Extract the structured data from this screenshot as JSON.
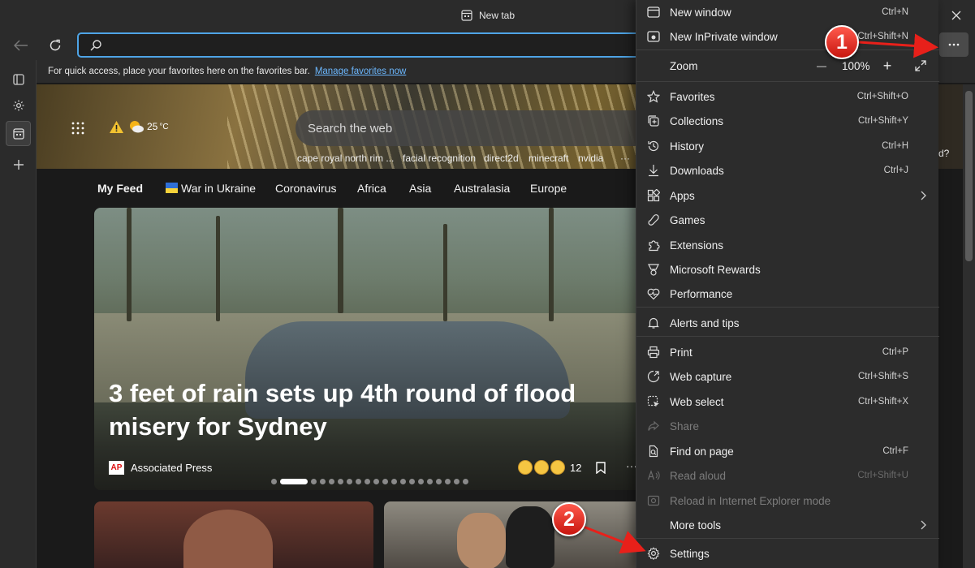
{
  "window": {
    "tab_title": "New tab"
  },
  "toolbar": {
    "address_value": ""
  },
  "favorites_bar": {
    "message": "For quick access, place your favorites here on the favorites bar.",
    "link": "Manage favorites now"
  },
  "hero": {
    "weather_temp": "25",
    "weather_unit": "°C",
    "search_placeholder": "Search the web",
    "trending": [
      "cape royal north rim ...",
      "facial recognition",
      "direct2d",
      "minecraft",
      "nvidia"
    ],
    "more": "···",
    "right_snippet": "d?"
  },
  "feed_tabs": [
    "My Feed",
    "War in Ukraine",
    "Coronavirus",
    "Africa",
    "Asia",
    "Australasia",
    "Europe"
  ],
  "top_story": {
    "headline": "3 feet of rain sets up 4th round of flood misery for Sydney",
    "source": "Associated Press",
    "source_logo": "AP",
    "reaction_count": "12",
    "more": "···",
    "carousel_count": 20,
    "carousel_active": 1
  },
  "menu": {
    "items": [
      {
        "label": "New window",
        "shortcut": "Ctrl+N",
        "icon": "window-icon"
      },
      {
        "label": "New InPrivate window",
        "shortcut": "Ctrl+Shift+N",
        "icon": "inprivate-icon"
      },
      {
        "label": "Favorites",
        "shortcut": "Ctrl+Shift+O",
        "icon": "star-icon"
      },
      {
        "label": "Collections",
        "shortcut": "Ctrl+Shift+Y",
        "icon": "collections-icon"
      },
      {
        "label": "History",
        "shortcut": "Ctrl+H",
        "icon": "history-icon"
      },
      {
        "label": "Downloads",
        "shortcut": "Ctrl+J",
        "icon": "download-icon"
      },
      {
        "label": "Apps",
        "shortcut": "",
        "icon": "apps-icon"
      },
      {
        "label": "Games",
        "shortcut": "",
        "icon": "games-icon"
      },
      {
        "label": "Extensions",
        "shortcut": "",
        "icon": "extensions-icon"
      },
      {
        "label": "Microsoft Rewards",
        "shortcut": "",
        "icon": "rewards-icon"
      },
      {
        "label": "Performance",
        "shortcut": "",
        "icon": "performance-icon"
      },
      {
        "label": "Alerts and tips",
        "shortcut": "",
        "icon": "bell-icon"
      },
      {
        "label": "Print",
        "shortcut": "Ctrl+P",
        "icon": "print-icon"
      },
      {
        "label": "Web capture",
        "shortcut": "Ctrl+Shift+S",
        "icon": "web-capture-icon"
      },
      {
        "label": "Web select",
        "shortcut": "Ctrl+Shift+X",
        "icon": "web-select-icon"
      },
      {
        "label": "Share",
        "shortcut": "",
        "icon": "share-icon"
      },
      {
        "label": "Find on page",
        "shortcut": "Ctrl+F",
        "icon": "find-icon"
      },
      {
        "label": "Read aloud",
        "shortcut": "Ctrl+Shift+U",
        "icon": "read-aloud-icon"
      },
      {
        "label": "Reload in Internet Explorer mode",
        "shortcut": "",
        "icon": "ie-mode-icon"
      },
      {
        "label": "More tools",
        "shortcut": "",
        "icon": ""
      },
      {
        "label": "Settings",
        "shortcut": "",
        "icon": "gear-icon"
      }
    ],
    "zoom": {
      "label": "Zoom",
      "value": "100%",
      "minus": "—",
      "plus": "+"
    }
  },
  "annotations": {
    "step1": "1",
    "step2": "2",
    "arrow_color": "#e8201a"
  },
  "colors": {
    "accent": "#4ea4e6",
    "link": "#6cb8ff",
    "menu_bg": "#2c2c2c"
  }
}
